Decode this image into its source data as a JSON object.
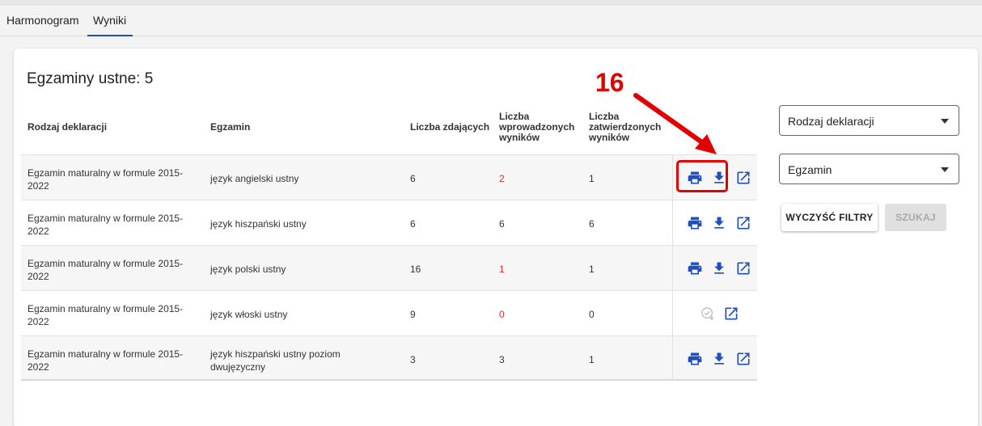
{
  "tabs": [
    "Harmonogram",
    "Wyniki"
  ],
  "active_tab": "Wyniki",
  "title": "Egzaminy ustne: 5",
  "table": {
    "columns": [
      "Rodzaj deklaracji",
      "Egzamin",
      "Liczba zdających",
      "Liczba wprowadzonych wyników",
      "Liczba zatwierdzonych wyników"
    ],
    "col_lines": [
      [
        "Rodzaj deklaracji"
      ],
      [
        "Egzamin"
      ],
      [
        "Liczba zdających"
      ],
      [
        "Liczba",
        "wprowadzonych",
        "wyników"
      ],
      [
        "Liczba",
        "zatwierdzonych",
        "wyników"
      ]
    ],
    "rows": [
      {
        "type": "Egzamin maturalny w formule 2015-2022",
        "exam": "język angielski ustny",
        "students": "6",
        "entered": "2",
        "approved": "1",
        "entered_red": true,
        "actions": [
          "print-icon",
          "download-icon",
          "open-external-icon"
        ]
      },
      {
        "type": "Egzamin maturalny w formule 2015-2022",
        "exam": "język hiszpański ustny",
        "students": "6",
        "entered": "6",
        "approved": "6",
        "entered_red": false,
        "actions": [
          "print-icon",
          "download-icon",
          "open-external-icon"
        ]
      },
      {
        "type": "Egzamin maturalny w formule 2015-2022",
        "exam": "język polski ustny",
        "students": "16",
        "entered": "1",
        "approved": "1",
        "entered_red": true,
        "actions": [
          "print-icon",
          "download-icon",
          "open-external-icon"
        ]
      },
      {
        "type": "Egzamin maturalny w formule 2015-2022",
        "exam": "język włoski ustny",
        "students": "9",
        "entered": "0",
        "approved": "0",
        "entered_red": true,
        "actions": [
          "approve-disabled-icon",
          "open-external-icon"
        ]
      },
      {
        "type": "Egzamin maturalny w formule 2015-2022",
        "exam": "język hiszpański ustny poziom dwujęzyczny",
        "students": "3",
        "entered": "3",
        "approved": "1",
        "entered_red": false,
        "actions": [
          "print-icon",
          "download-icon",
          "open-external-icon"
        ]
      }
    ]
  },
  "filters": {
    "declaration_type": "Rodzaj deklaracji",
    "exam": "Egzamin",
    "clear_label": "WYCZYŚĆ FILTRY",
    "search_label": "SZUKAJ",
    "search_disabled": true
  },
  "annotation": {
    "number": "16"
  },
  "colors": {
    "accent": "#1e4fbf",
    "red": "#d32f2f",
    "annotation": "#e00000"
  }
}
